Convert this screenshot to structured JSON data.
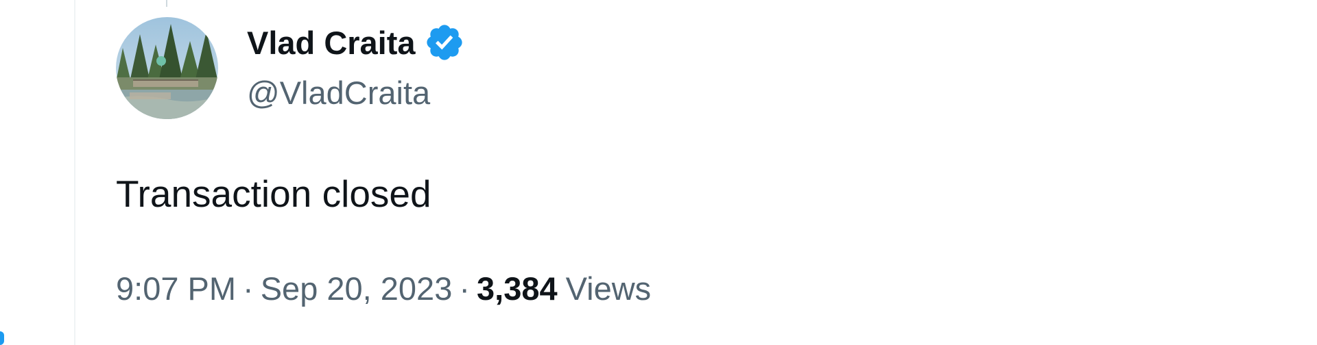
{
  "tweet": {
    "author": {
      "display_name": "Vlad Craita",
      "handle": "@VladCraita",
      "verified": true,
      "verified_color": "#1d9bf0"
    },
    "text": "Transaction closed",
    "meta": {
      "time": "9:07 PM",
      "separator": "·",
      "date": "Sep 20, 2023",
      "views_count": "3,384",
      "views_label": "Views"
    }
  },
  "icons": {
    "verified": "verified-badge-icon",
    "avatar": "profile-photo-landscape"
  },
  "colors": {
    "text_primary": "#0f1419",
    "text_secondary": "#536471",
    "accent": "#1d9bf0",
    "divider": "#eff3f4"
  }
}
